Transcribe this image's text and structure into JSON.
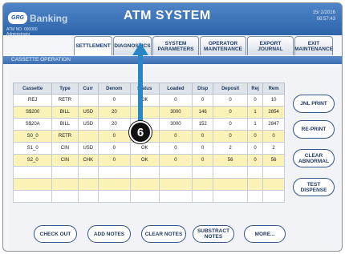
{
  "header": {
    "logo_badge": "GRG",
    "logo_text": "Banking",
    "title": "ATM SYSTEM",
    "date": "15/ 2/2016",
    "time": "08:57:43",
    "atm_no": "ATM NO: 000000",
    "user": "Administrator"
  },
  "tabs": [
    {
      "label": "SETTLEMENT",
      "active": true
    },
    {
      "label": "DIAGNOSTICS",
      "active": false
    },
    {
      "label": "SYSTEM PARAMETERS",
      "active": false
    },
    {
      "label": "OPERATOR MAINTENANCE",
      "active": false
    },
    {
      "label": "EXPORT JOURNAL",
      "active": false
    },
    {
      "label": "EXIT MAINTENANCE",
      "active": false
    }
  ],
  "section": {
    "label": "CASSETTE OPERATION"
  },
  "table": {
    "columns": [
      "Cassette",
      "Type",
      "Curr",
      "Denom",
      "Status",
      "Loaded",
      "Disp",
      "Deposit",
      "Rej",
      "Rem"
    ],
    "rows": [
      {
        "cells": [
          "REJ",
          "RETR",
          "",
          "0",
          "OK",
          "0",
          "0",
          "0",
          "0",
          "10"
        ],
        "highlight": false
      },
      {
        "cells": [
          "S$200",
          "BILL",
          "USD",
          "20",
          "",
          "3000",
          "146",
          "0",
          "1",
          "2854"
        ],
        "highlight": true
      },
      {
        "cells": [
          "S$20A",
          "BILL",
          "USD",
          "20",
          "",
          "3000",
          "152",
          "0",
          "1",
          "2847"
        ],
        "highlight": false
      },
      {
        "cells": [
          "S0_0",
          "RETR",
          "",
          "0",
          "OK",
          "0",
          "0",
          "0",
          "0",
          "0"
        ],
        "highlight": true
      },
      {
        "cells": [
          "S1_0",
          "CIN",
          "USD",
          "0",
          "OK",
          "0",
          "0",
          "2",
          "0",
          "2"
        ],
        "highlight": false
      },
      {
        "cells": [
          "S2_0",
          "CIN",
          "CHK",
          "0",
          "OK",
          "0",
          "0",
          "56",
          "0",
          "56"
        ],
        "highlight": true
      },
      {
        "cells": [
          "",
          "",
          "",
          "",
          "",
          "",
          "",
          "",
          "",
          ""
        ],
        "highlight": false
      },
      {
        "cells": [
          "",
          "",
          "",
          "",
          "",
          "",
          "",
          "",
          "",
          ""
        ],
        "highlight": true
      },
      {
        "cells": [
          "",
          "",
          "",
          "",
          "",
          "",
          "",
          "",
          "",
          ""
        ],
        "highlight": false
      }
    ]
  },
  "side_buttons": [
    "JNL PRINT",
    "RE-PRINT",
    "CLEAR ABNORMAL",
    "TEST DISPENSE"
  ],
  "bottom_buttons": [
    "CHECK OUT",
    "ADD NOTES",
    "CLEAR NOTES",
    "SUBSTRACT NOTES",
    "MORE..."
  ],
  "callout": {
    "number": "6"
  },
  "colors": {
    "header": "#2d63a8",
    "highlight_row": "#fbf2b8",
    "callout_arrow": "#2b86c6"
  }
}
